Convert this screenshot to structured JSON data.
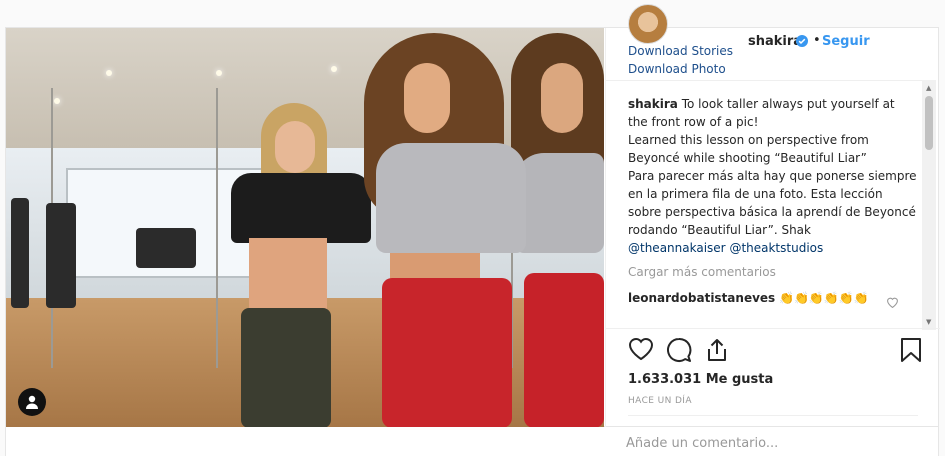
{
  "header": {
    "username": "shakira",
    "separator": "•",
    "follow_label": "Seguir",
    "download_stories": "Download Stories",
    "download_photo": "Download Photo"
  },
  "caption": {
    "user": "shakira",
    "line1": "To look taller always put yourself at the front row of a pic!",
    "line2": "Learned this lesson on perspective from Beyoncé while shooting “Beautiful Liar”",
    "line3": "Para parecer más alta hay que ponerse siempre en la primera fila de una foto. Esta lección sobre perspectiva básica la aprendí de Beyoncé rodando “Beautiful Liar”. Shak",
    "mention1": "@theannakaiser",
    "mention2": "@theaktstudios"
  },
  "load_more_label": "Cargar más comentarios",
  "comments": [
    {
      "user": "leonardobatistaneves",
      "text": "👏👏👏👏👏👏"
    }
  ],
  "likes": "1.633.031 Me gusta",
  "timestamp": "HACE UN DÍA",
  "add_comment_placeholder": "Añade un comentario...",
  "icons": {
    "like": "heart-icon",
    "comment": "comment-icon",
    "share": "share-icon",
    "save": "bookmark-icon",
    "verified": "verified-badge-icon",
    "tag": "user-tag-icon"
  },
  "colors": {
    "link": "#3897f0",
    "download_link": "#1e4f8c",
    "muted": "#999999",
    "text": "#262626"
  }
}
